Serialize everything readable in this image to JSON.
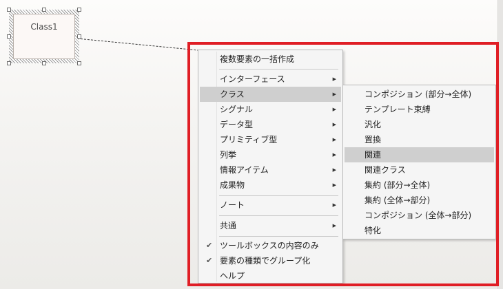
{
  "diagram": {
    "class_name": "Class1"
  },
  "context_menu": {
    "items": [
      {
        "label": "複数要素の一括作成",
        "submenu": false
      },
      {
        "label": "インターフェース",
        "submenu": true
      },
      {
        "label": "クラス",
        "submenu": true,
        "highlighted": true
      },
      {
        "label": "シグナル",
        "submenu": true
      },
      {
        "label": "データ型",
        "submenu": true
      },
      {
        "label": "プリミティブ型",
        "submenu": true
      },
      {
        "label": "列挙",
        "submenu": true
      },
      {
        "label": "情報アイテム",
        "submenu": true
      },
      {
        "label": "成果物",
        "submenu": true
      },
      {
        "label": "ノート",
        "submenu": true
      },
      {
        "label": "共通",
        "submenu": true
      },
      {
        "label": "ツールボックスの内容のみ",
        "checked": true
      },
      {
        "label": "要素の種類でグループ化",
        "checked": true
      },
      {
        "label": "ヘルプ",
        "submenu": false
      }
    ],
    "submenu_arrow": "▶",
    "check_glyph": "✔"
  },
  "class_submenu": {
    "items": [
      {
        "label": "コンポジション (部分→全体)"
      },
      {
        "label": "テンプレート束縛"
      },
      {
        "label": "汎化"
      },
      {
        "label": "置換"
      },
      {
        "label": "関連",
        "highlighted": true
      },
      {
        "label": "関連クラス"
      },
      {
        "label": "集約 (部分→全体)"
      },
      {
        "label": "集約 (全体→部分)"
      },
      {
        "label": "コンポジション (全体→部分)"
      },
      {
        "label": "特化"
      }
    ]
  },
  "colors": {
    "highlight_frame": "#e01e25",
    "menu_background": "#f5f5f5",
    "hover_background": "#cfcfcf"
  }
}
